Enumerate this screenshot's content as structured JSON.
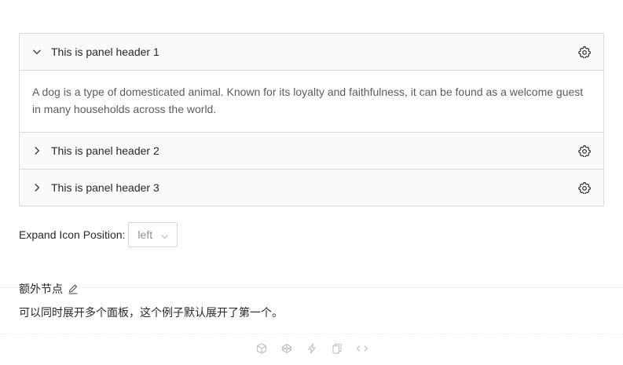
{
  "collapse": {
    "panels": [
      {
        "header": "This is panel header 1",
        "expanded": true,
        "content": "A dog is a type of domesticated animal. Known for its loyalty and faithfulness, it can be found as a welcome guest in many households across the world."
      },
      {
        "header": "This is panel header 2",
        "expanded": false
      },
      {
        "header": "This is panel header 3",
        "expanded": false
      }
    ]
  },
  "expand_icon_position": {
    "label": "Expand Icon Position:",
    "value": "left"
  },
  "meta": {
    "title": "额外节点",
    "description": "可以同时展开多个面板，这个例子默认展开了第一个。"
  },
  "actions": [
    "codesandbox-icon",
    "codepen-icon",
    "stackblitz-icon",
    "copy-icon",
    "code-icon"
  ],
  "colors": {
    "border": "#d9d9d9",
    "header_bg": "#fafafa",
    "text": "rgba(0,0,0,0.85)",
    "content_text": "rgba(0,0,0,0.65)",
    "icon": "#bfbfbf"
  }
}
